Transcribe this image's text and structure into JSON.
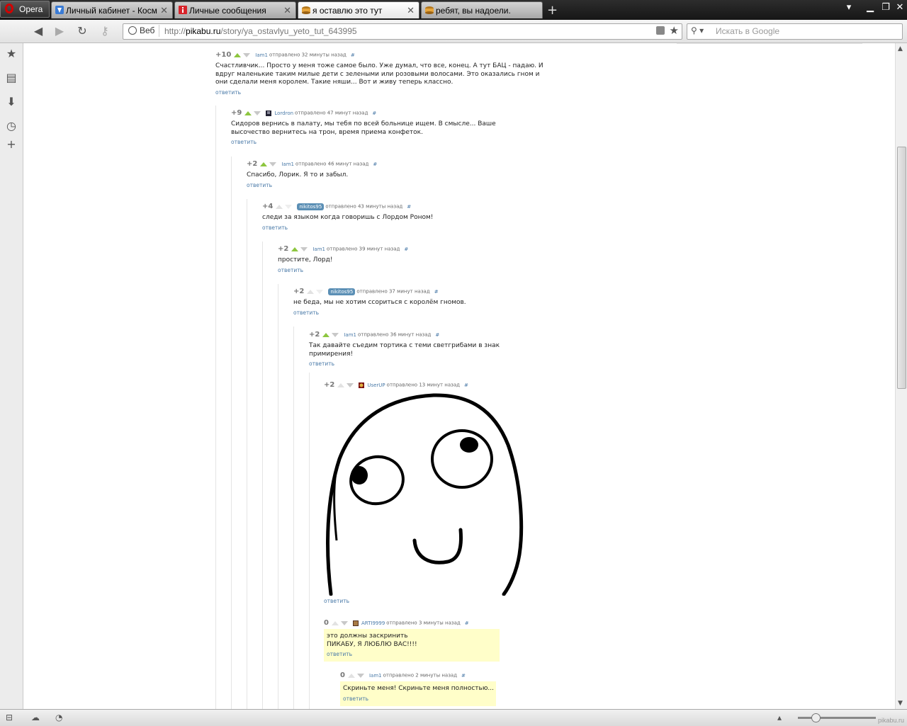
{
  "browser": {
    "menu_label": "Opera",
    "tabs": [
      {
        "label": "Личный кабинет - Косм...",
        "active": false
      },
      {
        "label": "Личные сообщения",
        "active": false
      },
      {
        "label": "я оставлю это тут",
        "active": true
      },
      {
        "label": "ребят, вы надоели.",
        "active": false
      }
    ],
    "address": {
      "web_label": "Веб",
      "url_prefix": "http://",
      "url_domain": "pikabu.ru",
      "url_path": "/story/ya_ostavlyu_yeto_tut_643995"
    },
    "search_placeholder": "Искать в Google",
    "watermark": "pikabu.ru"
  },
  "comments": [
    {
      "rating": "+10",
      "author": "Iam1",
      "meta": "отправлено 32 минуты назад",
      "hash": "#",
      "text": "Счастливчик... Просто у меня тоже самое было. Уже думал, что все, конец. А тут БАЦ - падаю. И вдруг маленькие таким милые дети с зелеными или розовыми волосами. Это оказались гном и они сделали меня королем. Такие няши... Вот и живу теперь классно.",
      "reply": "ответить"
    },
    {
      "rating": "+9",
      "author": "Lordron",
      "meta": "отправлено 47 минут назад",
      "hash": "#",
      "text": "Сидоров вернись в палату, мы тебя по всей больнице ищем. В смысле... Ваше высочество вернитесь на трон, время приема конфеток.",
      "reply": "ответить"
    },
    {
      "rating": "+2",
      "author": "Iam1",
      "meta": "отправлено 46 минут назад",
      "hash": "#",
      "text": "Спасибо, Лорик. Я то и забыл.",
      "reply": "ответить"
    },
    {
      "rating": "+4",
      "author": "nikitos95",
      "meta": "отправлено 43 минуты назад",
      "hash": "#",
      "text": "следи за языком когда говоришь с Лордом Роном!",
      "reply": "ответить"
    },
    {
      "rating": "+2",
      "author": "Iam1",
      "meta": "отправлено 39 минут назад",
      "hash": "#",
      "text": "простите, Лорд!",
      "reply": "ответить"
    },
    {
      "rating": "+2",
      "author": "nikitos95",
      "meta": "отправлено 37 минут назад",
      "hash": "#",
      "text": "не беда, мы не хотим ссориться с королём гномов.",
      "reply": "ответить"
    },
    {
      "rating": "+2",
      "author": "Iam1",
      "meta": "отправлено 36 минут назад",
      "hash": "#",
      "text": "Так давайте съедим тортика с теми светгрибами в знак примирения!",
      "reply": "ответить"
    },
    {
      "rating": "+2",
      "author": "UserUP",
      "meta": "отправлено 13 минут назад",
      "hash": "#",
      "text": "",
      "reply": "ответить"
    },
    {
      "rating": "0",
      "author": "ARTI9999",
      "meta": "отправлено 3 минуты назад",
      "hash": "#",
      "text": "это должны заскринить\nПИКАБУ, Я ЛЮБЛЮ ВАС!!!!",
      "reply": "ответить"
    },
    {
      "rating": "0",
      "author": "Iam1",
      "meta": "отправлено 2 минуты назад",
      "hash": "#",
      "text": "Скриньте меня! Скриньте меня полностью...",
      "reply": "ответить"
    }
  ]
}
